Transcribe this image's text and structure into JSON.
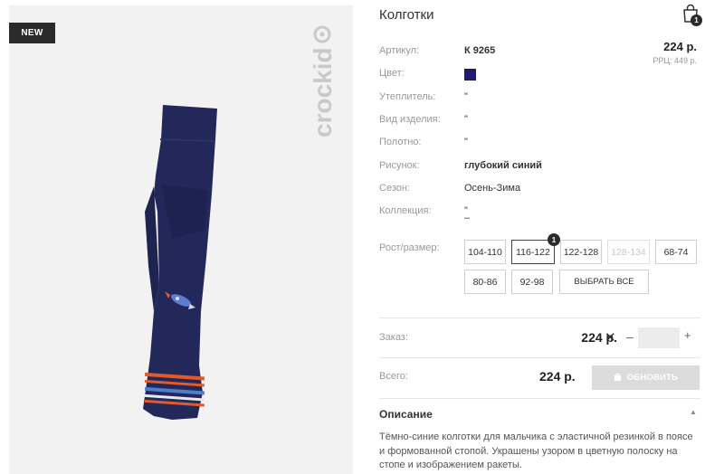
{
  "image": {
    "badge": "NEW",
    "brand_logo": "crockid"
  },
  "product": {
    "title": "Колготки",
    "cart_count": "1",
    "price": "224 р.",
    "rrp": "РРЦ: 449 р.",
    "specs": [
      {
        "label": "Артикул:",
        "value": "К 9265"
      },
      {
        "label": "Цвет:",
        "value": ""
      },
      {
        "label": "Утеплитель:",
        "value": "\""
      },
      {
        "label": "Вид изделия:",
        "value": "\""
      },
      {
        "label": "Полотно:",
        "value": "\""
      },
      {
        "label": "Рисунок:",
        "value": "глубокий синий"
      },
      {
        "label": "Сезон:",
        "value": "Осень-Зима"
      },
      {
        "label": "Коллекция:",
        "value": "\""
      },
      {
        "label": "",
        "value": "–"
      }
    ],
    "swatch_color": "#1f1a7a"
  },
  "sizes": {
    "label": "Рост/размер:",
    "options": [
      "104-110",
      "116-122",
      "122-128",
      "128-134",
      "68-74",
      "80-86",
      "92-98"
    ],
    "selected": "116-122",
    "selected_count": "1",
    "disabled": "128-134",
    "select_all": "ВЫБРАТЬ ВСЕ"
  },
  "order": {
    "label": "Заказ:",
    "price": "224 р.",
    "times": "✕",
    "minus": "–",
    "plus": "+",
    "qty": ""
  },
  "total": {
    "label": "Всего:",
    "price": "224 р.",
    "update_button": "ОБНОВИТЬ"
  },
  "description": {
    "heading": "Описание",
    "text": "Тёмно-синие колготки для мальчика с эластичной резинкой в поясе и формованной стопой. Украшены узором в цветную полоску на стопе и изображением ракеты."
  }
}
